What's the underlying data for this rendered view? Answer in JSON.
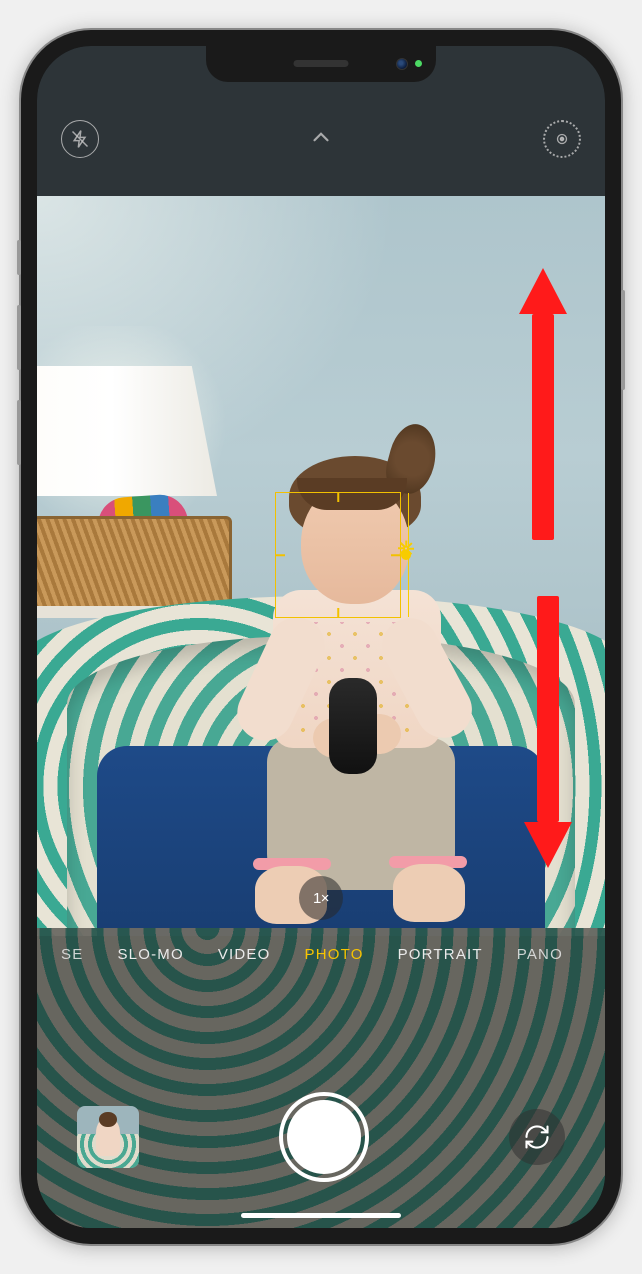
{
  "top_bar": {
    "flash_icon": "flash-off-icon",
    "chevron_icon": "chevron-up-icon",
    "live_icon": "live-photo-icon"
  },
  "viewfinder": {
    "zoom_label": "1×",
    "focus_indicator": "focus-square",
    "exposure_indicator": "exposure-sun-icon"
  },
  "modes": {
    "items": [
      {
        "label": "SE",
        "active": false
      },
      {
        "label": "SLO-MO",
        "active": false
      },
      {
        "label": "VIDEO",
        "active": false
      },
      {
        "label": "PHOTO",
        "active": true
      },
      {
        "label": "PORTRAIT",
        "active": false
      },
      {
        "label": "PANO",
        "active": false
      }
    ]
  },
  "controls": {
    "thumbnail_name": "last-photo-thumbnail",
    "shutter_name": "shutter-button",
    "flip_name": "flip-camera-button",
    "flip_icon": "flip-camera-icon"
  },
  "annotation": {
    "arrow_up": "swipe-up-arrow",
    "arrow_down": "swipe-down-arrow",
    "color": "#ff1a1a"
  }
}
